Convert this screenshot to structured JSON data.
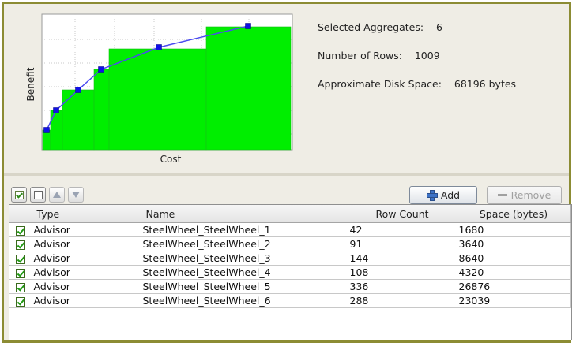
{
  "chart": {
    "xlabel": "Cost",
    "ylabel": "Benefit",
    "bar_color": "#00ee00",
    "line_color": "#4a4af0",
    "point_color": "#1010e6"
  },
  "stats": {
    "selected_aggregates_label": "Selected Aggregates:",
    "selected_aggregates_value": "6",
    "number_of_rows_label": "Number of Rows:",
    "number_of_rows_value": "1009",
    "disk_space_label": "Approximate Disk Space:",
    "disk_space_value": "68196 bytes"
  },
  "toolbar": {
    "select_all_icon": "checked-box-icon",
    "deselect_all_icon": "empty-box-icon",
    "move_up_icon": "triangle-up-icon",
    "move_down_icon": "triangle-down-icon",
    "add_label": "Add",
    "remove_label": "Remove"
  },
  "table": {
    "columns": [
      "Type",
      "Name",
      "Row Count",
      "Space (bytes)"
    ],
    "rows": [
      {
        "checked": true,
        "type": "Advisor",
        "name": "SteelWheel_SteelWheel_1",
        "row_count": "42",
        "space": "1680"
      },
      {
        "checked": true,
        "type": "Advisor",
        "name": "SteelWheel_SteelWheel_2",
        "row_count": "91",
        "space": "3640"
      },
      {
        "checked": true,
        "type": "Advisor",
        "name": "SteelWheel_SteelWheel_3",
        "row_count": "144",
        "space": "8640"
      },
      {
        "checked": true,
        "type": "Advisor",
        "name": "SteelWheel_SteelWheel_4",
        "row_count": "108",
        "space": "4320"
      },
      {
        "checked": true,
        "type": "Advisor",
        "name": "SteelWheel_SteelWheel_5",
        "row_count": "336",
        "space": "26876"
      },
      {
        "checked": true,
        "type": "Advisor",
        "name": "SteelWheel_SteelWheel_6",
        "row_count": "288",
        "space": "23039"
      }
    ]
  }
}
